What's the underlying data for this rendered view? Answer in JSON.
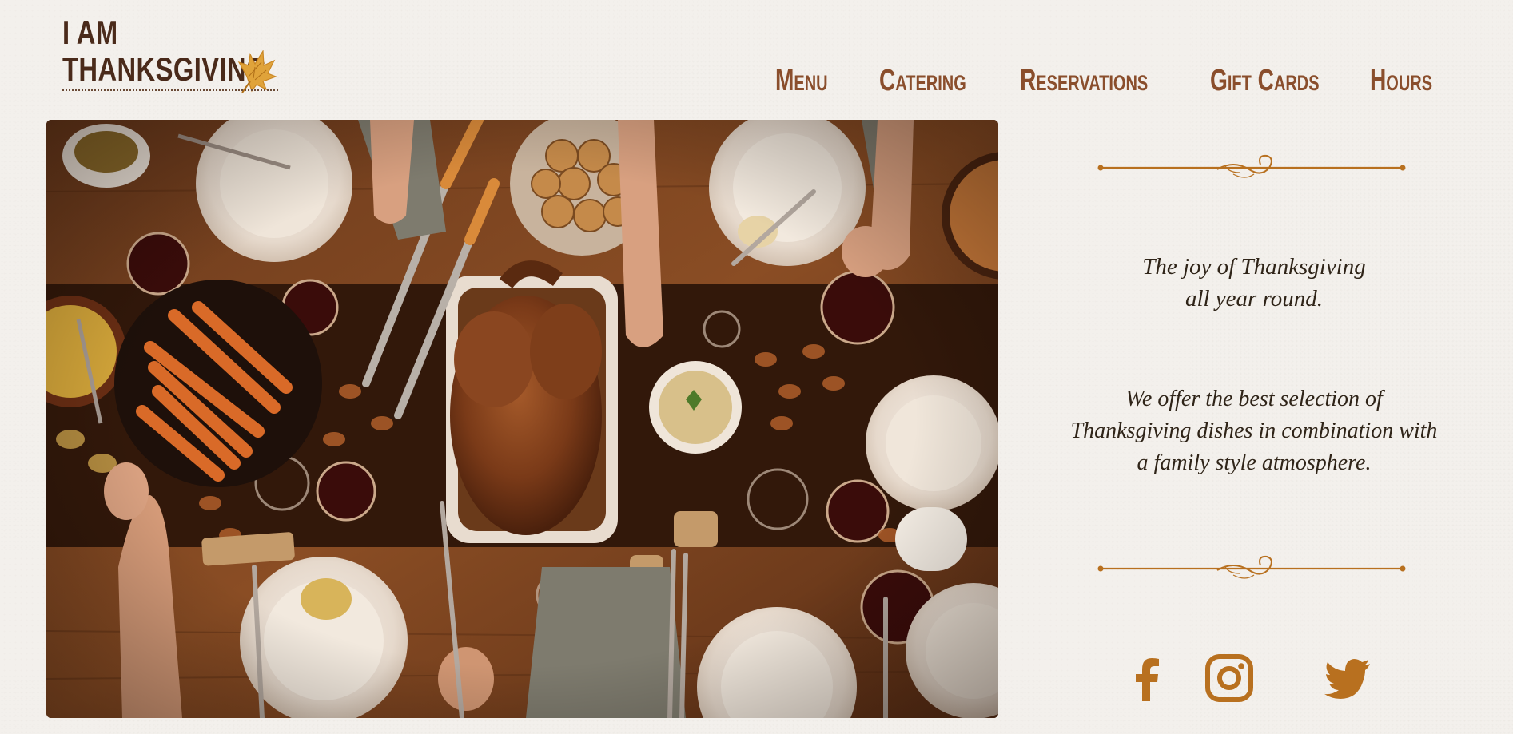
{
  "brand": {
    "line1": "I AM",
    "line2": "THANKSGIVING",
    "leaf_icon": "maple-leaf-icon"
  },
  "nav": {
    "items": [
      {
        "label": "Menu"
      },
      {
        "label": "Catering"
      },
      {
        "label": "Reservations"
      },
      {
        "label": "Gift Cards"
      },
      {
        "label": "Hours"
      }
    ]
  },
  "hero": {
    "subject": "thanksgiving-table-photo"
  },
  "panel": {
    "tagline": [
      "The joy of Thanksgiving",
      "all year round."
    ],
    "description": [
      "We offer the best selection of",
      "Thanksgiving dishes in combination with",
      "a family style atmosphere."
    ],
    "divider_icon": "ornamental-divider-icon"
  },
  "social": [
    {
      "icon": "facebook-icon"
    },
    {
      "icon": "instagram-icon"
    },
    {
      "icon": "twitter-icon"
    }
  ],
  "colors": {
    "background": "#f3f0ec",
    "brand_dark": "#4a2a1a",
    "nav": "#8a4e2c",
    "accent": "#b8701f",
    "text": "#2f2418"
  }
}
